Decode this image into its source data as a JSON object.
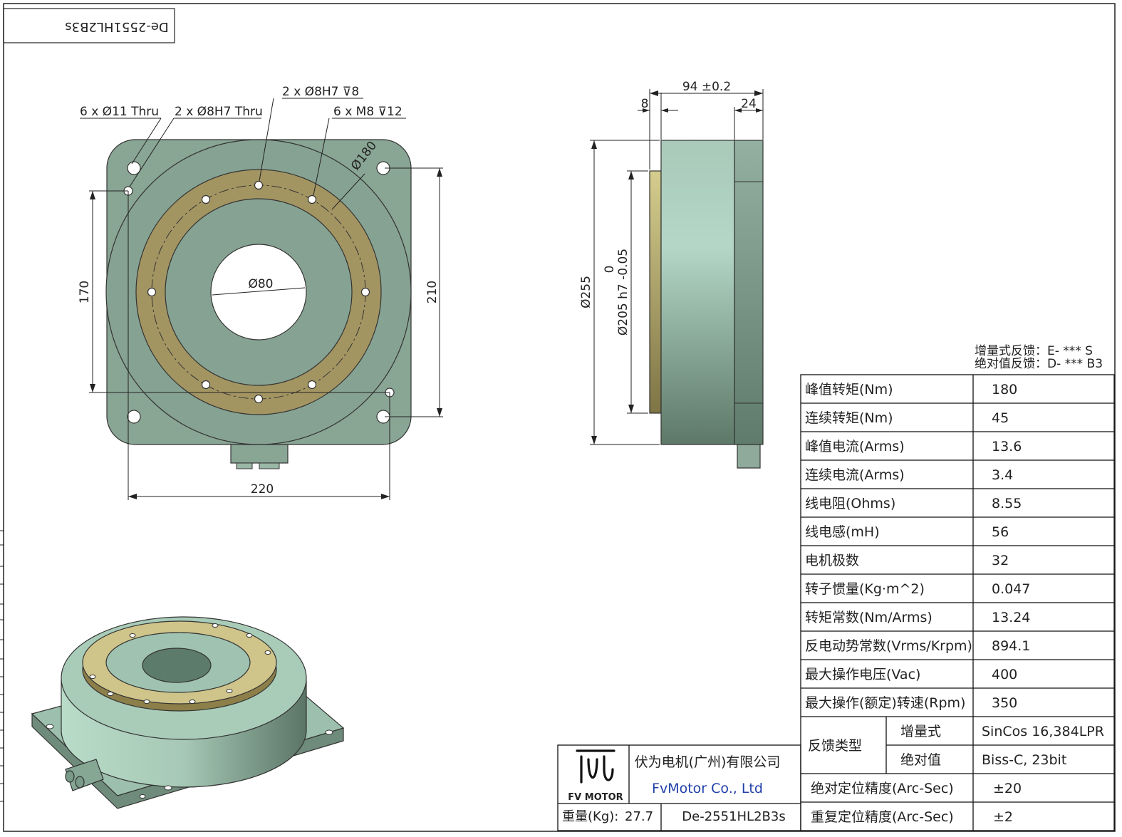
{
  "drawing_code": "De-2551HL2B3s",
  "top_view": {
    "callout_holes_thru": "6 x Ø11 Thru",
    "callout_pin_thru": "2 x Ø8H7 Thru",
    "callout_pin_depth": "2 x Ø8H7 ⊽8",
    "callout_threads": "6 x M8 ⊽12",
    "dim_pcd": "Ø180",
    "dim_bore": "Ø80",
    "dim_170": "170",
    "dim_210": "210",
    "dim_220": "220"
  },
  "side_view": {
    "dim_length": "94 ±0.2",
    "dim_8": "8",
    "dim_24": "24",
    "dim_255": "Ø255",
    "dim_205": "Ø205 h7 -0.05",
    "dim_205_upper": "0"
  },
  "feedback_note": {
    "line1": "增量式反馈：E- *** S",
    "line2": "绝对值反馈：D- *** B3"
  },
  "specs": [
    {
      "label": "峰值转矩(Nm)",
      "value": "180"
    },
    {
      "label": "连续转矩(Nm)",
      "value": "45"
    },
    {
      "label": "峰值电流(Arms)",
      "value": "13.6"
    },
    {
      "label": "连续电流(Arms)",
      "value": "3.4"
    },
    {
      "label": "线电阻(Ohms)",
      "value": "8.55"
    },
    {
      "label": "线电感(mH)",
      "value": "56"
    },
    {
      "label": "电机极数",
      "value": "32"
    },
    {
      "label": "转子惯量(Kg·m^2)",
      "value": "0.047"
    },
    {
      "label": "转矩常数(Nm/Arms)",
      "value": "13.24"
    },
    {
      "label": "反电动势常数(Vrms/Krpm)",
      "value": "894.1"
    },
    {
      "label": "最大操作电压(Vac)",
      "value": "400"
    },
    {
      "label": "最大操作(额定)转速(Rpm)",
      "value": "350"
    }
  ],
  "feedback_type": {
    "label": "反馈类型",
    "incremental_label": "增量式",
    "incremental_value": "SinCos 16,384LPR",
    "absolute_label": "绝对值",
    "absolute_value": "Biss-C, 23bit"
  },
  "accuracy": [
    {
      "label": "绝对定位精度(Arc-Sec)",
      "value": "±20"
    },
    {
      "label": "重复定位精度(Arc-Sec)",
      "value": "±2"
    }
  ],
  "title_block": {
    "logo_text": "FV MOTOR",
    "company_cn": "伏为电机(广州)有限公司",
    "company_en": "FvMotor Co., Ltd",
    "weight_label": "重量(Kg):",
    "weight_value": "27.7",
    "part_number": "De-2551HL2B3s"
  },
  "colors": {
    "housing": "#8aa596",
    "housing_dark": "#5e7a6a",
    "rotor_ring": "#a39562",
    "side_light": "#b1d4c4",
    "brand_blue": "#1f3fa8"
  }
}
